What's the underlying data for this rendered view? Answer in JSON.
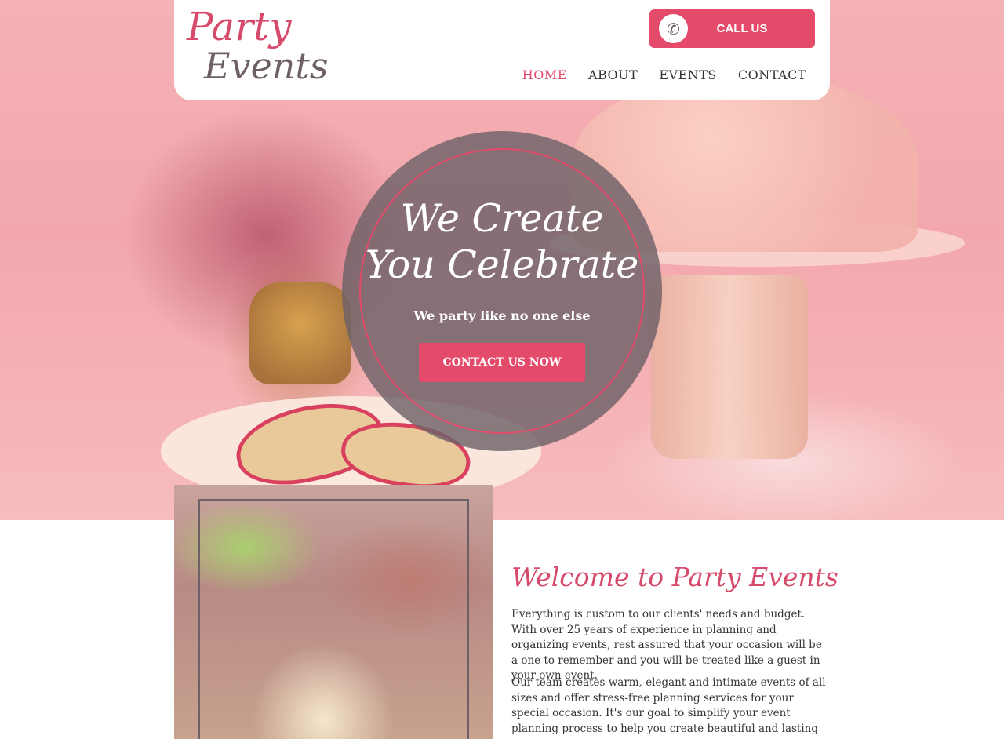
{
  "header": {
    "logo_line1": "Party",
    "logo_line2": "Events",
    "call_label": "CALL US",
    "phone_icon": "phone-icon"
  },
  "nav": {
    "items": [
      "HOME",
      "ABOUT",
      "EVENTS",
      "CONTACT"
    ],
    "active": "HOME"
  },
  "hero": {
    "title_line1": "We Create",
    "title_line2": "You Celebrate",
    "subtitle": "We party like no one else",
    "button": "CONTACT US NOW"
  },
  "welcome": {
    "title": "Welcome to Party Events",
    "paragraph1": "Everything is custom to our clients' needs and budget. With over 25 years of experience in planning and organizing events, rest assured that your occasion will be a one to remember and you will be treated like a guest in your own event.",
    "paragraph2": "Our team creates warm, elegant and intimate events of all sizes and offer stress-free planning services for your special occasion. It's our goal to simplify your event planning process to help you create beautiful and lasting memories."
  },
  "colors": {
    "accent": "#e44a6a",
    "logo_gray": "#6f6067",
    "overlay": "#6e6268"
  }
}
